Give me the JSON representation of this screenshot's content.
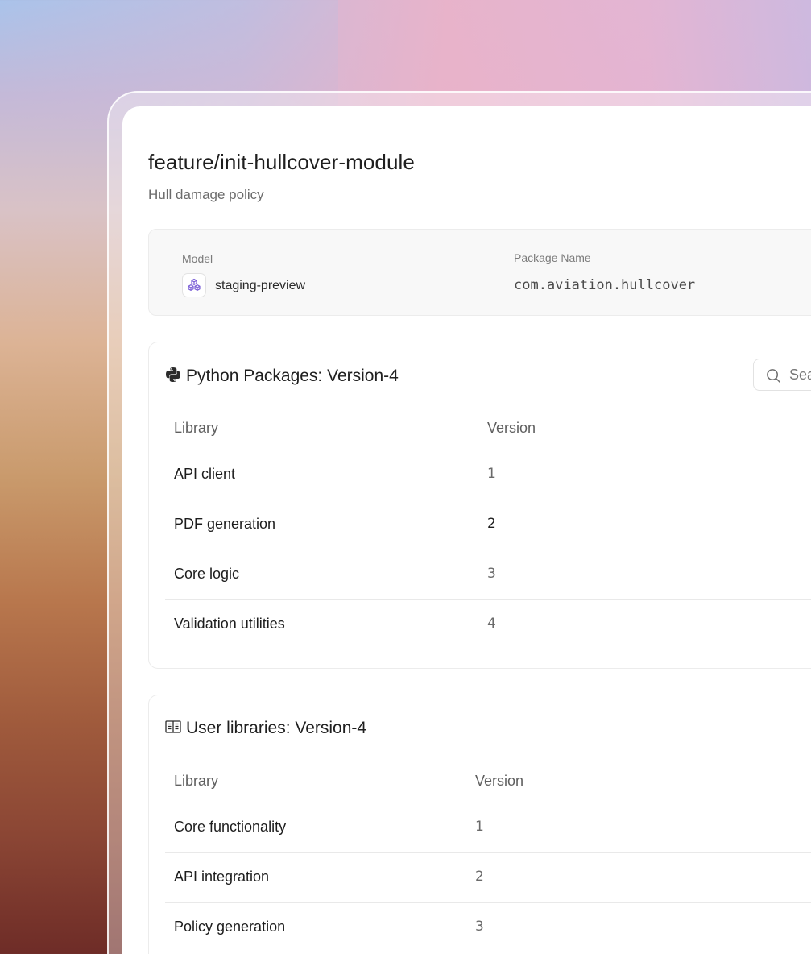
{
  "branch": {
    "title": "feature/init-hullcover-module",
    "subtitle": "Hull damage policy"
  },
  "info": {
    "model_label": "Model",
    "model_value": "staging-preview",
    "model_icon": "cubes-icon",
    "package_label": "Package Name",
    "package_value": "com.aviation.hullcover"
  },
  "python_packages": {
    "icon": "python-icon",
    "title": "Python Packages: Version-4",
    "search_placeholder": "Search",
    "columns": {
      "library": "Library",
      "version": "Version"
    },
    "rows": [
      {
        "library": "API client",
        "version": "1"
      },
      {
        "library": "PDF generation",
        "version": "2"
      },
      {
        "library": "Core logic",
        "version": "3"
      },
      {
        "library": "Validation utilities",
        "version": "4"
      }
    ]
  },
  "user_libraries": {
    "icon": "book-icon",
    "title": "User libraries: Version-4",
    "columns": {
      "library": "Library",
      "version": "Version"
    },
    "rows": [
      {
        "library": "Core functionality",
        "version": "1"
      },
      {
        "library": "API integration",
        "version": "2"
      },
      {
        "library": "Policy generation",
        "version": "3"
      }
    ]
  },
  "colors": {
    "model_icon_accent": "#7b5fd6",
    "panel_background": "#ffffff",
    "card_background": "#f8f8f8"
  }
}
